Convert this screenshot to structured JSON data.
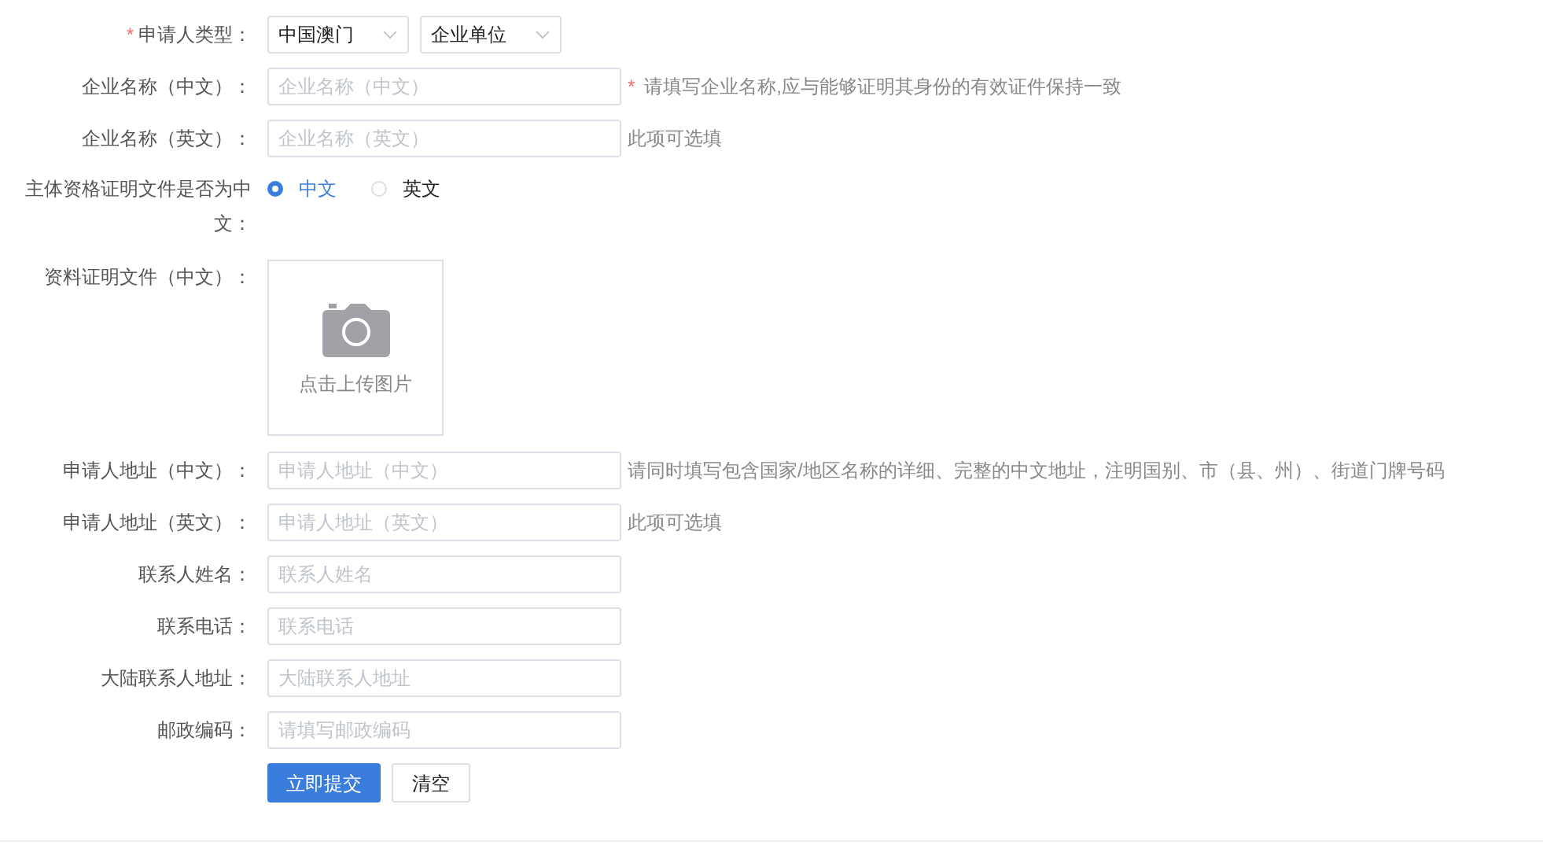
{
  "rows": [
    {
      "kind": "select",
      "label": "申请人类型：",
      "mark": "*",
      "selects": [
        {
          "value": "中国澳门"
        },
        {
          "value": "企业单位"
        }
      ]
    },
    {
      "kind": "input",
      "label": "企业名称（中文）：",
      "placeholder": "企业名称（中文）",
      "hint": "请填写企业名称,应与能够证明其身份的有效证件保持一致",
      "hint_mark": "*"
    },
    {
      "kind": "input",
      "label": "企业名称（英文）：",
      "placeholder": "企业名称（英文）",
      "hint": "此项可选填"
    },
    {
      "kind": "radio",
      "label": "主体资格证明文件是否为中文：",
      "options": [
        {
          "label": "中文",
          "selected": true
        },
        {
          "label": "英文",
          "selected": false
        }
      ]
    },
    {
      "kind": "upload",
      "label": "资料证明文件（中文）：",
      "caption": "点击上传图片"
    },
    {
      "kind": "input",
      "label": "申请人地址（中文）：",
      "placeholder": "申请人地址（中文）",
      "hint": "请同时填写包含国家/地区名称的详细、完整的中文地址，注明国别、市（县、州）、街道门牌号码"
    },
    {
      "kind": "input",
      "label": "申请人地址（英文）：",
      "placeholder": "申请人地址（英文）",
      "hint": "此项可选填"
    },
    {
      "kind": "input",
      "label": "联系人姓名：",
      "placeholder": "联系人姓名"
    },
    {
      "kind": "input",
      "label": "联系电话：",
      "placeholder": "联系电话"
    },
    {
      "kind": "input",
      "label": "大陆联系人地址：",
      "placeholder": "大陆联系人地址"
    },
    {
      "kind": "input",
      "label": "邮政编码：",
      "placeholder": "请填写邮政编码"
    }
  ],
  "buttons": [
    {
      "label": "立即提交",
      "kind": "primary"
    },
    {
      "label": "清空",
      "kind": "default"
    }
  ]
}
